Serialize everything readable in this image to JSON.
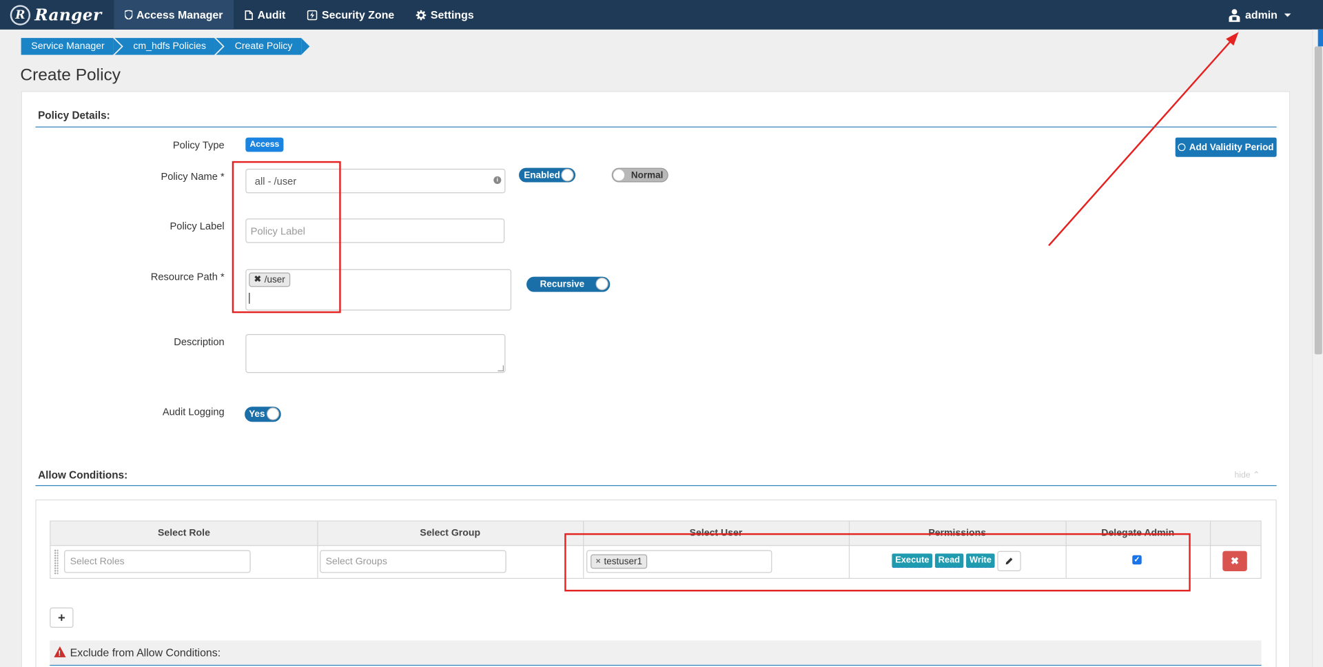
{
  "nav": {
    "brand": "Ranger",
    "brand_logo_letter": "R",
    "items": [
      {
        "label": "Access Manager",
        "icon": "shield-icon"
      },
      {
        "label": "Audit",
        "icon": "file-icon"
      },
      {
        "label": "Security Zone",
        "icon": "bolt-icon"
      },
      {
        "label": "Settings",
        "icon": "gear-icon"
      }
    ],
    "user": "admin"
  },
  "breadcrumb": [
    "Service Manager",
    "cm_hdfs Policies",
    "Create Policy"
  ],
  "page_title": "Create Policy",
  "policy_details": {
    "title": "Policy Details:",
    "policy_type_label": "Policy Type",
    "policy_type_value": "Access",
    "policy_name_label": "Policy Name *",
    "policy_name_value": "all - /user",
    "enabled_toggle": "Enabled",
    "normal_toggle": "Normal",
    "add_validity_label": "Add Validity Period",
    "policy_label_label": "Policy Label",
    "policy_label_placeholder": "Policy Label",
    "resource_path_label": "Resource Path *",
    "resource_path_tag": "/user",
    "recursive_toggle": "Recursive",
    "description_label": "Description",
    "audit_logging_label": "Audit Logging",
    "audit_logging_value": "Yes"
  },
  "allow": {
    "title": "Allow Conditions:",
    "hide_link": "hide",
    "columns": [
      "Select Role",
      "Select Group",
      "Select User",
      "Permissions",
      "Delegate Admin"
    ],
    "roles_placeholder": "Select Roles",
    "groups_placeholder": "Select Groups",
    "user_tag": "testuser1",
    "permissions": [
      "Execute",
      "Read",
      "Write"
    ],
    "delegate_admin_checked": true,
    "add_button": "+"
  },
  "exclude": {
    "title": "Exclude from Allow Conditions:"
  },
  "colors": {
    "navbar": "#1f3a57",
    "accent": "#1a84c7",
    "annotation": "#e52222",
    "danger": "#d9534f"
  }
}
